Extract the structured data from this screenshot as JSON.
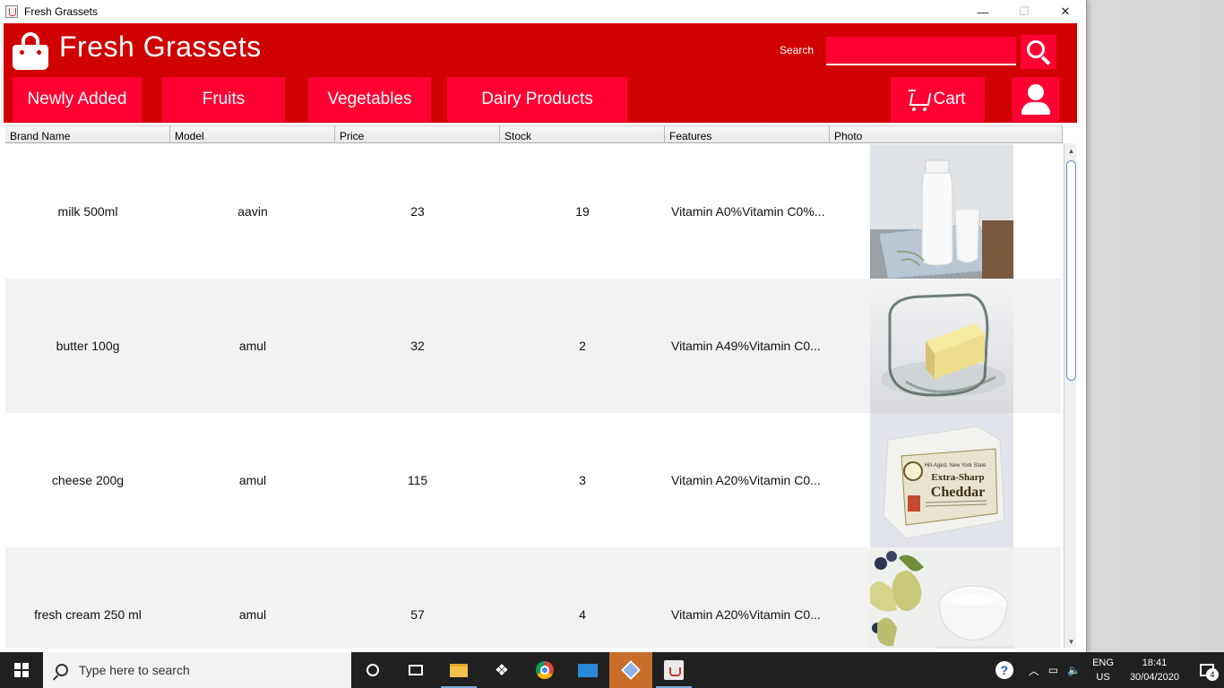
{
  "window": {
    "title": "Fresh Grassets",
    "minimize_glyph": "—",
    "maximize_glyph": "☐",
    "close_glyph": "✕"
  },
  "header": {
    "brand": "Fresh Grassets",
    "search_label": "Search",
    "search_value": "",
    "logo_icon": "shopping-bag-icon",
    "accent_color": "#d10000",
    "button_color": "#ff0033"
  },
  "nav": {
    "newly_added": "Newly Added",
    "fruits": "Fruits",
    "vegetables": "Vegetables",
    "dairy": "Dairy Products",
    "cart": "Cart"
  },
  "table": {
    "columns": [
      "Brand Name",
      "Model",
      "Price",
      "Stock",
      "Features",
      "Photo"
    ],
    "rows": [
      {
        "brand": "milk 500ml",
        "model": "aavin",
        "price": "23",
        "stock": "19",
        "features": "Vitamin A0%Vitamin C0%...",
        "photo": "milk-photo"
      },
      {
        "brand": "butter 100g",
        "model": "amul",
        "price": "32",
        "stock": "2",
        "features": "Vitamin A49%Vitamin C0...",
        "photo": "butter-photo"
      },
      {
        "brand": "cheese 200g",
        "model": "amul",
        "price": "115",
        "stock": "3",
        "features": "Vitamin A20%Vitamin C0...",
        "photo": "cheese-photo"
      },
      {
        "brand": "fresh cream 250 ml",
        "model": "amul",
        "price": "57",
        "stock": "4",
        "features": "Vitamin A20%Vitamin C0...",
        "photo": "cream-photo"
      }
    ],
    "cheese_label_top": "Hill-Aged, New York State",
    "cheese_label_main1": "Extra-Sharp",
    "cheese_label_main2": "Cheddar"
  },
  "taskbar": {
    "search_placeholder": "Type here to search",
    "lang_top": "ENG",
    "lang_bottom": "US",
    "time": "18:41",
    "date": "30/04/2020",
    "notification_count": "4",
    "help_glyph": "?"
  }
}
